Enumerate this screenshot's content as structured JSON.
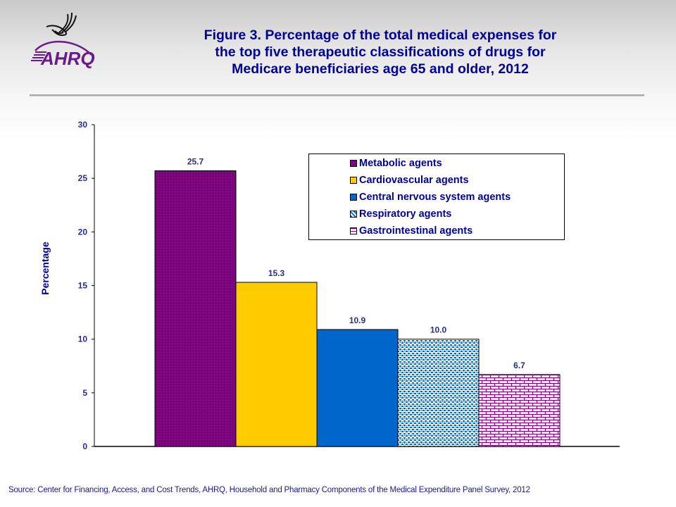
{
  "header": {
    "logo_text": "AHRQ",
    "title_lines": [
      "Figure 3. Percentage of the total medical expenses for",
      "the top five therapeutic classifications of drugs for",
      "Medicare beneficiaries age 65 and older, 2012"
    ]
  },
  "colors": {
    "title": "#000099",
    "metabolic": "#7f0080",
    "cardiovascular": "#ffcc00",
    "cns": "#0066cc",
    "respiratory": "#0066cc",
    "gastrointestinal": "#800080"
  },
  "chart_data": {
    "type": "bar",
    "title": "Figure 3. Percentage of the total medical expenses for the top five therapeutic classifications of drugs for Medicare beneficiaries age 65 and older, 2012",
    "xlabel": "",
    "ylabel": "Percentage",
    "ylim": [
      0,
      30
    ],
    "yticks": [
      0,
      5,
      10,
      15,
      20,
      25,
      30
    ],
    "grid": false,
    "legend_position": "top-right",
    "categories": [
      "Metabolic agents",
      "Cardiovascular agents",
      "Central nervous system agents",
      "Respiratory agents",
      "Gastrointestinal agents"
    ],
    "series": [
      {
        "name": "Metabolic agents",
        "values": [
          25.7
        ],
        "label": "25.7",
        "fill": "solid",
        "color": "#7f0080"
      },
      {
        "name": "Cardiovascular agents",
        "values": [
          15.3
        ],
        "label": "15.3",
        "fill": "solid",
        "color": "#ffcc00"
      },
      {
        "name": "Central nervous system agents",
        "values": [
          10.9
        ],
        "label": "10.9",
        "fill": "solid",
        "color": "#0066cc"
      },
      {
        "name": "Respiratory agents",
        "values": [
          10.0
        ],
        "label": "10.0",
        "fill": "dotted",
        "color": "#0066cc"
      },
      {
        "name": "Gastrointestinal agents",
        "values": [
          6.7
        ],
        "label": "6.7",
        "fill": "brick",
        "color": "#800080"
      }
    ]
  },
  "footer": {
    "source": "Source: Center for Financing, Access, and Cost Trends, AHRQ, Household and Pharmacy Components of the Medical Expenditure Panel Survey,  2012"
  }
}
